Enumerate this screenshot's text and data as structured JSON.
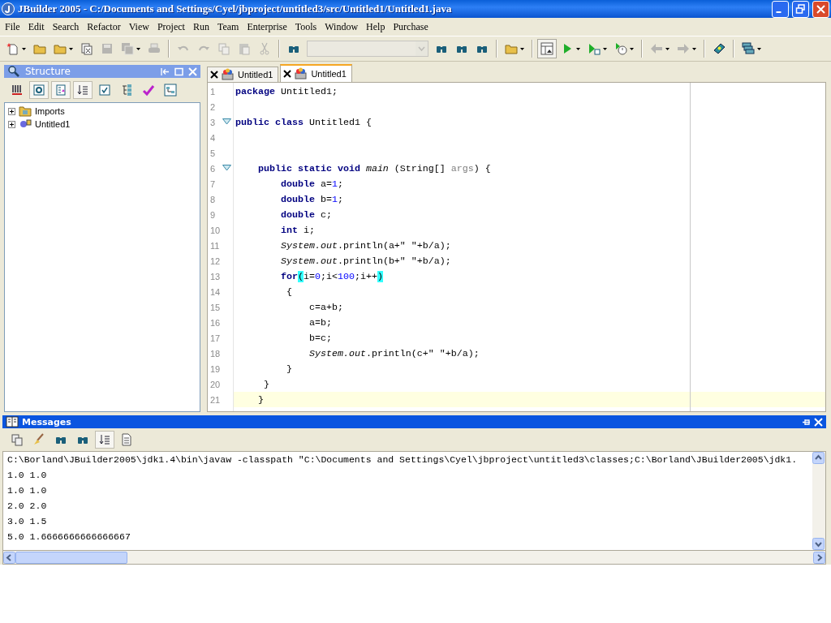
{
  "window": {
    "title": "JBuilder 2005 - C:/Documents and Settings/Cyel/jbproject/untitled3/src/Untitled1/Untitled1.java"
  },
  "menu": [
    "File",
    "Edit",
    "Search",
    "Refactor",
    "View",
    "Project",
    "Run",
    "Team",
    "Enterprise",
    "Tools",
    "Window",
    "Help",
    "Purchase"
  ],
  "toolbar": [
    {
      "kind": "new",
      "disabled": false,
      "dropdown": true
    },
    {
      "kind": "open",
      "disabled": false,
      "dropdown": false
    },
    {
      "kind": "reopen",
      "disabled": false,
      "dropdown": true
    },
    {
      "kind": "close",
      "disabled": false,
      "dropdown": false
    },
    {
      "kind": "save",
      "disabled": true,
      "dropdown": false
    },
    {
      "kind": "save-all",
      "disabled": true,
      "dropdown": true
    },
    {
      "kind": "print",
      "disabled": true,
      "dropdown": false
    },
    {
      "kind": "separator"
    },
    {
      "kind": "undo",
      "disabled": true,
      "dropdown": false
    },
    {
      "kind": "redo",
      "disabled": true,
      "dropdown": false
    },
    {
      "kind": "copy",
      "disabled": true,
      "dropdown": false
    },
    {
      "kind": "paste",
      "disabled": true,
      "dropdown": false
    },
    {
      "kind": "cut",
      "disabled": true,
      "dropdown": false
    },
    {
      "kind": "separator"
    },
    {
      "kind": "find",
      "disabled": false,
      "dropdown": false
    },
    {
      "kind": "combo",
      "disabled": true
    },
    {
      "kind": "find-again",
      "disabled": false,
      "dropdown": false
    },
    {
      "kind": "find-class",
      "disabled": false,
      "dropdown": false
    },
    {
      "kind": "find-folder",
      "disabled": false,
      "dropdown": false
    },
    {
      "kind": "separator"
    },
    {
      "kind": "make",
      "disabled": false,
      "dropdown": true
    },
    {
      "kind": "separator"
    },
    {
      "kind": "pane",
      "disabled": false,
      "dropdown": false,
      "on": true
    },
    {
      "kind": "run",
      "disabled": false,
      "dropdown": true
    },
    {
      "kind": "debug",
      "disabled": false,
      "dropdown": true
    },
    {
      "kind": "optimize",
      "disabled": false,
      "dropdown": true
    },
    {
      "kind": "separator"
    },
    {
      "kind": "back",
      "disabled": true,
      "dropdown": true
    },
    {
      "kind": "forward",
      "disabled": true,
      "dropdown": true
    },
    {
      "kind": "separator"
    },
    {
      "kind": "help",
      "disabled": false,
      "dropdown": false
    },
    {
      "kind": "separator"
    },
    {
      "kind": "windows",
      "disabled": false,
      "dropdown": true
    }
  ],
  "structure": {
    "title": "Structure",
    "toolbar": [
      {
        "kind": "bars",
        "on": false
      },
      {
        "kind": "cycle",
        "on": true
      },
      {
        "kind": "list",
        "on": true
      },
      {
        "kind": "sort",
        "on": true
      },
      {
        "kind": "check",
        "on": false
      },
      {
        "kind": "tree",
        "on": false
      },
      {
        "kind": "wand",
        "on": false
      },
      {
        "kind": "hierarchy",
        "on": false
      }
    ],
    "tree": [
      {
        "kind": "imports",
        "label": "Imports",
        "expanded": false
      },
      {
        "kind": "class",
        "label": "Untitled1",
        "expanded": false
      }
    ]
  },
  "editor": {
    "tabs": [
      {
        "label": "Untitled1",
        "selected": false
      },
      {
        "label": "Untitled1",
        "selected": true
      }
    ],
    "lines": [
      {
        "number": "1",
        "fold": false,
        "current": false,
        "tokens": [
          {
            "kind": "kw",
            "text": "package"
          },
          {
            "kind": "plain",
            "text": " Untitled1;"
          }
        ]
      },
      {
        "number": "2",
        "fold": false
      },
      {
        "number": "3",
        "fold": true,
        "current": false,
        "tokens": [
          {
            "kind": "kw",
            "text": "public class"
          },
          {
            "kind": "plain",
            "text": " Untitled1 {"
          }
        ]
      },
      {
        "number": "4",
        "fold": false
      },
      {
        "number": "5",
        "fold": false
      },
      {
        "number": "6",
        "fold": true,
        "current": false,
        "tokens": [
          {
            "kind": "kw",
            "text": "    public static void"
          },
          {
            "kind": "italic",
            "text": " main"
          },
          {
            "kind": "plain",
            "text": " (String[] "
          },
          {
            "kind": "param",
            "text": "args"
          },
          {
            "kind": "plain",
            "text": ") {"
          }
        ]
      },
      {
        "number": "7",
        "fold": false,
        "current": false,
        "tokens": [
          {
            "kind": "kw",
            "text": "        double"
          },
          {
            "kind": "plain",
            "text": " a="
          },
          {
            "kind": "num",
            "text": "1"
          },
          {
            "kind": "plain",
            "text": ";"
          }
        ]
      },
      {
        "number": "8",
        "fold": false,
        "current": false,
        "tokens": [
          {
            "kind": "kw",
            "text": "        double"
          },
          {
            "kind": "plain",
            "text": " b="
          },
          {
            "kind": "num",
            "text": "1"
          },
          {
            "kind": "plain",
            "text": ";"
          }
        ]
      },
      {
        "number": "9",
        "fold": false,
        "current": false,
        "tokens": [
          {
            "kind": "kw",
            "text": "        double"
          },
          {
            "kind": "plain",
            "text": " c;"
          }
        ]
      },
      {
        "number": "10",
        "fold": false,
        "current": false,
        "tokens": [
          {
            "kind": "kw",
            "text": "        int"
          },
          {
            "kind": "plain",
            "text": " i;"
          }
        ]
      },
      {
        "number": "11",
        "fold": false,
        "current": false,
        "tokens": [
          {
            "kind": "italic",
            "text": "        System.out"
          },
          {
            "kind": "plain",
            "text": ".println(a+\" \"+b/a);"
          }
        ]
      },
      {
        "number": "12",
        "fold": false,
        "current": false,
        "tokens": [
          {
            "kind": "italic",
            "text": "        System.out"
          },
          {
            "kind": "plain",
            "text": ".println(b+\" \"+b/a);"
          }
        ]
      },
      {
        "number": "13",
        "fold": false,
        "current": false,
        "tokens": [
          {
            "kind": "kw",
            "text": "        for"
          },
          {
            "kind": "bracket",
            "text": "("
          },
          {
            "kind": "plain",
            "text": "i="
          },
          {
            "kind": "num",
            "text": "0"
          },
          {
            "kind": "plain",
            "text": ";i<"
          },
          {
            "kind": "num",
            "text": "100"
          },
          {
            "kind": "plain",
            "text": ";i++"
          },
          {
            "kind": "bracket",
            "text": ")"
          }
        ]
      },
      {
        "number": "14",
        "fold": false,
        "current": false,
        "tokens": [
          {
            "kind": "plain",
            "text": "         {"
          }
        ]
      },
      {
        "number": "15",
        "fold": false,
        "current": false,
        "tokens": [
          {
            "kind": "plain",
            "text": "             c=a+b;"
          }
        ]
      },
      {
        "number": "16",
        "fold": false,
        "current": false,
        "tokens": [
          {
            "kind": "plain",
            "text": "             a=b;"
          }
        ]
      },
      {
        "number": "17",
        "fold": false,
        "current": false,
        "tokens": [
          {
            "kind": "plain",
            "text": "             b=c;"
          }
        ]
      },
      {
        "number": "18",
        "fold": false,
        "current": false,
        "tokens": [
          {
            "kind": "italic",
            "text": "             System.out"
          },
          {
            "kind": "plain",
            "text": ".println(c+\" \"+b/a);"
          }
        ]
      },
      {
        "number": "19",
        "fold": false,
        "current": false,
        "tokens": [
          {
            "kind": "plain",
            "text": "         }"
          }
        ]
      },
      {
        "number": "20",
        "fold": false,
        "current": false,
        "tokens": [
          {
            "kind": "plain",
            "text": "     }"
          }
        ]
      },
      {
        "number": "21",
        "fold": false,
        "current": true,
        "tokens": [
          {
            "kind": "plain",
            "text": "    }"
          }
        ]
      }
    ]
  },
  "messages": {
    "title": "Messages",
    "toolbar": [
      {
        "kind": "copy",
        "on": false
      },
      {
        "kind": "brush",
        "on": false
      },
      {
        "kind": "find",
        "on": false
      },
      {
        "kind": "find-next",
        "on": false
      },
      {
        "kind": "sort",
        "on": true
      },
      {
        "kind": "document",
        "on": false
      }
    ],
    "output": [
      "C:\\Borland\\JBuilder2005\\jdk1.4\\bin\\javaw -classpath \"C:\\Documents and Settings\\Cyel\\jbproject\\untitled3\\classes;C:\\Borland\\JBuilder2005\\jdk1.",
      "1.0 1.0",
      "1.0 1.0",
      "2.0 2.0",
      "3.0 1.5",
      "5.0 1.6666666666666667"
    ]
  }
}
